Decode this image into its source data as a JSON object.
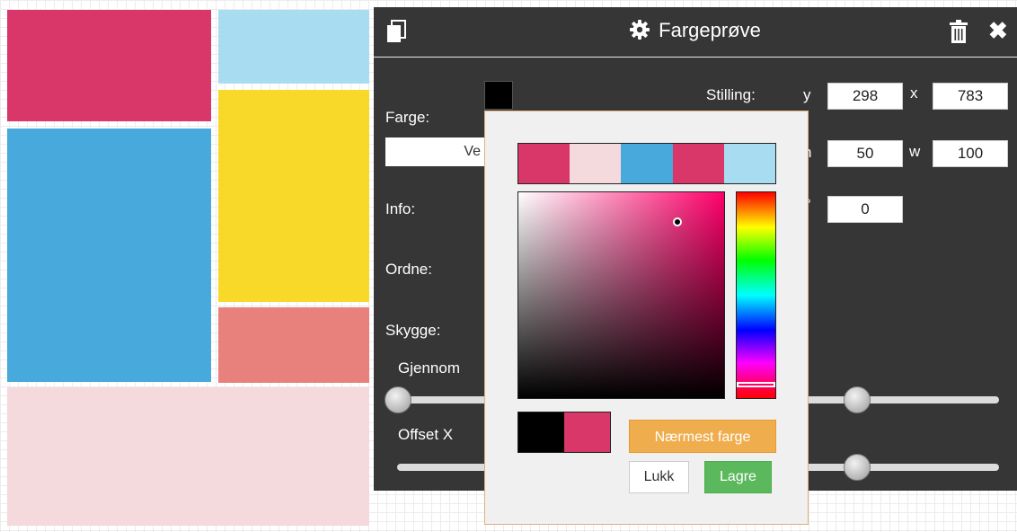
{
  "canvas": {
    "blocks": [
      {
        "color": "#d9376a"
      },
      {
        "color": "#a7dcf1"
      },
      {
        "color": "#47a9dc"
      },
      {
        "color": "#f8d92a"
      },
      {
        "color": "#e8807b"
      },
      {
        "color": "#f4d9dd"
      }
    ]
  },
  "dialog": {
    "title": "Fargeprøve",
    "icons": {
      "left": "copy-icon",
      "title": "gear-icon",
      "delete": "trash-icon",
      "close": "close-icon"
    },
    "labels": {
      "farge": "Farge:",
      "info": "Info:",
      "ordne": "Ordne:",
      "skygge": "Skygge:",
      "gjennom": "Gjennom",
      "offset_x": "Offset X",
      "stilling": "Stilling:",
      "y": "y",
      "x": "x",
      "h": "h",
      "w": "w",
      "rotation": "°"
    },
    "farge_field_value": "Ve",
    "fields": {
      "y": "298",
      "x": "783",
      "h": "50",
      "w": "100",
      "rotation": "0"
    },
    "sliders": {
      "opacity_level": 0.0,
      "offset_x_level": 0.0
    },
    "swatch_color": "#000000"
  },
  "color_picker": {
    "palette": [
      "#d9376a",
      "#f4d9dd",
      "#47a9dc",
      "#d9376a",
      "#a7dcf1"
    ],
    "hue_color": "#ff006a",
    "preview_old": "#000000",
    "preview_new": "#d9376a",
    "nearest_label": "Nærmest farge",
    "close_label": "Lukk",
    "save_label": "Lagre"
  }
}
